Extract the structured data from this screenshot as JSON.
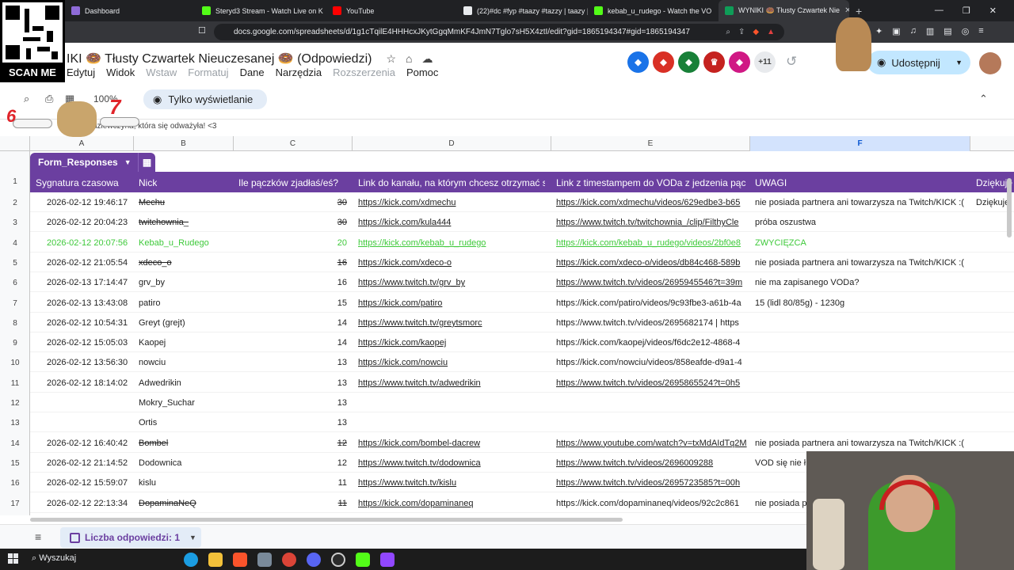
{
  "browser": {
    "tabs": [
      {
        "title": "Dashboard",
        "color": "#8e6bd8",
        "active": false
      },
      {
        "title": "Steryd3 Stream - Watch Live on K",
        "color": "#53fc18",
        "active": false
      },
      {
        "title": "YouTube",
        "color": "#ff0000",
        "active": false
      },
      {
        "title": "(22)#dc #fyp #taazy #tazzy | taazy | T",
        "color": "#e8eaed",
        "active": false
      },
      {
        "title": "kebab_u_rudego - Watch the VO",
        "color": "#53fc18",
        "active": false
      },
      {
        "title": "WYNIKI 🍩 Tłusty Czwartek Nie",
        "color": "#0f9d58",
        "active": true
      }
    ],
    "url": "docs.google.com/spreadsheets/d/1g1cTqilE4HHHcxJKytGgqMmKF4JmN7Tglo7sH5X4ztI/edit?gid=1865194347#gid=1865194347",
    "qr_label": "SCAN ME"
  },
  "sheets": {
    "title": "IKI 🍩 Tłusty Czwartek Nieuczesanej 🍩 (Odpowiedzi)",
    "menu": [
      {
        "label": "Edytuj",
        "disabled": false
      },
      {
        "label": "Widok",
        "disabled": false
      },
      {
        "label": "Wstaw",
        "disabled": true
      },
      {
        "label": "Formatuj",
        "disabled": true
      },
      {
        "label": "Dane",
        "disabled": false
      },
      {
        "label": "Narzędzia",
        "disabled": false
      },
      {
        "label": "Rozszerzenia",
        "disabled": true
      },
      {
        "label": "Pomoc",
        "disabled": false
      }
    ],
    "collaborators_more": "+11",
    "share_label": "Udostępnij",
    "zoom": "100%",
    "view_only": "Tylko wyświetlanie",
    "formula_text": "dziewczyna, która się odważyła! <3",
    "table_name": "Form_Responses",
    "sheet_tab": "Liczba odpowiedzi: 1",
    "colors": {
      "table": "#6b3fa0",
      "winner": "#3ec93a",
      "share": "#c2e7ff"
    }
  },
  "grid": {
    "columns": [
      "A",
      "B",
      "C",
      "D",
      "E",
      "F"
    ],
    "headers": [
      "Sygnatura czasowa",
      "Nick",
      "Ile pączków zjadłaś/eś?",
      "Link do kanału, na którym chcesz otrzymać s",
      "Link z timestampem do VODa z jedzenia pąc",
      "UWAGI",
      "Dziękuje"
    ],
    "rows": [
      {
        "num": "2",
        "ts": "2026-02-12 19:46:17",
        "nick": "Mechu",
        "count": "30",
        "link1": "https://kick.com/xdmechu",
        "link2": "https://kick.com/xdmechu/videos/629edbe3-b65",
        "note": "nie posiada partnera ani towarzysza na Twitch/KICK :(",
        "extra": "Dziękuje"
      },
      {
        "num": "3",
        "ts": "2026-02-12 20:04:23",
        "nick": "twitchownia_",
        "count": "30",
        "link1": "https://kick.com/kula444",
        "link2": "https://www.twitch.tv/twitchownia_/clip/FilthyCle",
        "note": "próba oszustwa",
        "extra": ""
      },
      {
        "num": "4",
        "ts": "2026-02-12 20:07:56",
        "nick": "Kebab_u_Rudego",
        "count": "20",
        "link1": "https://kick.com/kebab_u_rudego",
        "link2": "https://kick.com/kebab_u_rudego/videos/2bf0e8",
        "note": "ZWYCIĘZCA",
        "extra": ""
      },
      {
        "num": "5",
        "ts": "2026-02-12 21:05:54",
        "nick": "xdeco_o",
        "count": "16",
        "link1": "https://kick.com/xdeco-o",
        "link2": "https://kick.com/xdeco-o/videos/db84c468-589b",
        "note": "nie posiada partnera ani towarzysza na Twitch/KICK :(",
        "extra": ""
      },
      {
        "num": "6",
        "ts": "2026-02-13 17:14:47",
        "nick": "grv_by",
        "count": "16",
        "link1": "https://www.twitch.tv/grv_by",
        "link2": "https://www.twitch.tv/videos/2695945546?t=39m",
        "note": "nie ma zapisanego VODa?",
        "extra": ""
      },
      {
        "num": "7",
        "ts": "2026-02-13 13:43:08",
        "nick": "patiro",
        "count": "15",
        "link1": "https://kick.com/patiro",
        "link2": "https://kick.com/patiro/videos/9c93fbe3-a61b-4a",
        "note": "15 (lidl 80/85g) - 1230g",
        "extra": ""
      },
      {
        "num": "8",
        "ts": "2026-02-12 10:54:31",
        "nick": "Greyt (grejt)",
        "count": "14",
        "link1": "https://www.twitch.tv/greytsmorc",
        "link2": "https://www.twitch.tv/videos/2695682174 | https",
        "note": "",
        "extra": ""
      },
      {
        "num": "9",
        "ts": "2026-02-12 15:05:03",
        "nick": "Kaopej",
        "count": "14",
        "link1": "https://kick.com/kaopej",
        "link2": "https://kick.com/kaopej/videos/f6dc2e12-4868-4",
        "note": "",
        "extra": ""
      },
      {
        "num": "10",
        "ts": "2026-02-12 13:56:30",
        "nick": "nowciu",
        "count": "13",
        "link1": "https://kick.com/nowciu",
        "link2": "https://kick.com/nowciu/videos/858eafde-d9a1-4",
        "note": "",
        "extra": ""
      },
      {
        "num": "11",
        "ts": "2026-02-12 18:14:02",
        "nick": "Adwedrikin",
        "count": "13",
        "link1": "https://www.twitch.tv/adwedrikin",
        "link2": "https://www.twitch.tv/videos/2695865524?t=0h5",
        "note": "",
        "extra": ""
      },
      {
        "num": "12",
        "ts": "",
        "nick": "Mokry_Suchar",
        "count": "13",
        "link1": "",
        "link2": "",
        "note": "",
        "extra": ""
      },
      {
        "num": "13",
        "ts": "",
        "nick": "Ortis",
        "count": "13",
        "link1": "",
        "link2": "",
        "note": "",
        "extra": ""
      },
      {
        "num": "14",
        "ts": "2026-02-12 16:40:42",
        "nick": "Bombel",
        "count": "12",
        "link1": "https://kick.com/bombel-dacrew",
        "link2": "https://www.youtube.com/watch?v=txMdAIdTq2M",
        "note": "nie posiada partnera ani towarzysza na Twitch/KICK :(",
        "extra": ""
      },
      {
        "num": "15",
        "ts": "2026-02-12 21:14:52",
        "nick": "Dodownica",
        "count": "12",
        "link1": "https://www.twitch.tv/dodownica",
        "link2": "https://www.twitch.tv/videos/2696009288",
        "note": "VOD się nie ł",
        "extra": ""
      },
      {
        "num": "16",
        "ts": "2026-02-12 15:59:07",
        "nick": "kislu",
        "count": "11",
        "link1": "https://www.twitch.tv/kislu",
        "link2": "https://www.twitch.tv/videos/2695723585?t=00h",
        "note": "",
        "extra": ""
      },
      {
        "num": "17",
        "ts": "2026-02-12 22:13:34",
        "nick": "DopaminaNeQ",
        "count": "11",
        "link1": "https://kick.com/dopaminaneq",
        "link2": "https://kick.com/dopaminaneq/videos/92c2c861",
        "note": "nie posiada p",
        "extra": ""
      }
    ]
  },
  "taskbar": {
    "search": "Wyszukaj"
  }
}
